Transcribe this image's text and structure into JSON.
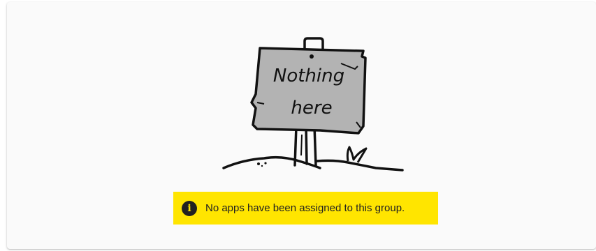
{
  "empty_state": {
    "sign_line1": "Nothing",
    "sign_line2": "here",
    "message": "No apps have been assigned to this group.",
    "icon": "info-icon"
  },
  "colors": {
    "card_background": "#fafafa",
    "notice_background": "#ffe500",
    "sign_fill": "#b3b3b3",
    "ink": "#111111"
  }
}
